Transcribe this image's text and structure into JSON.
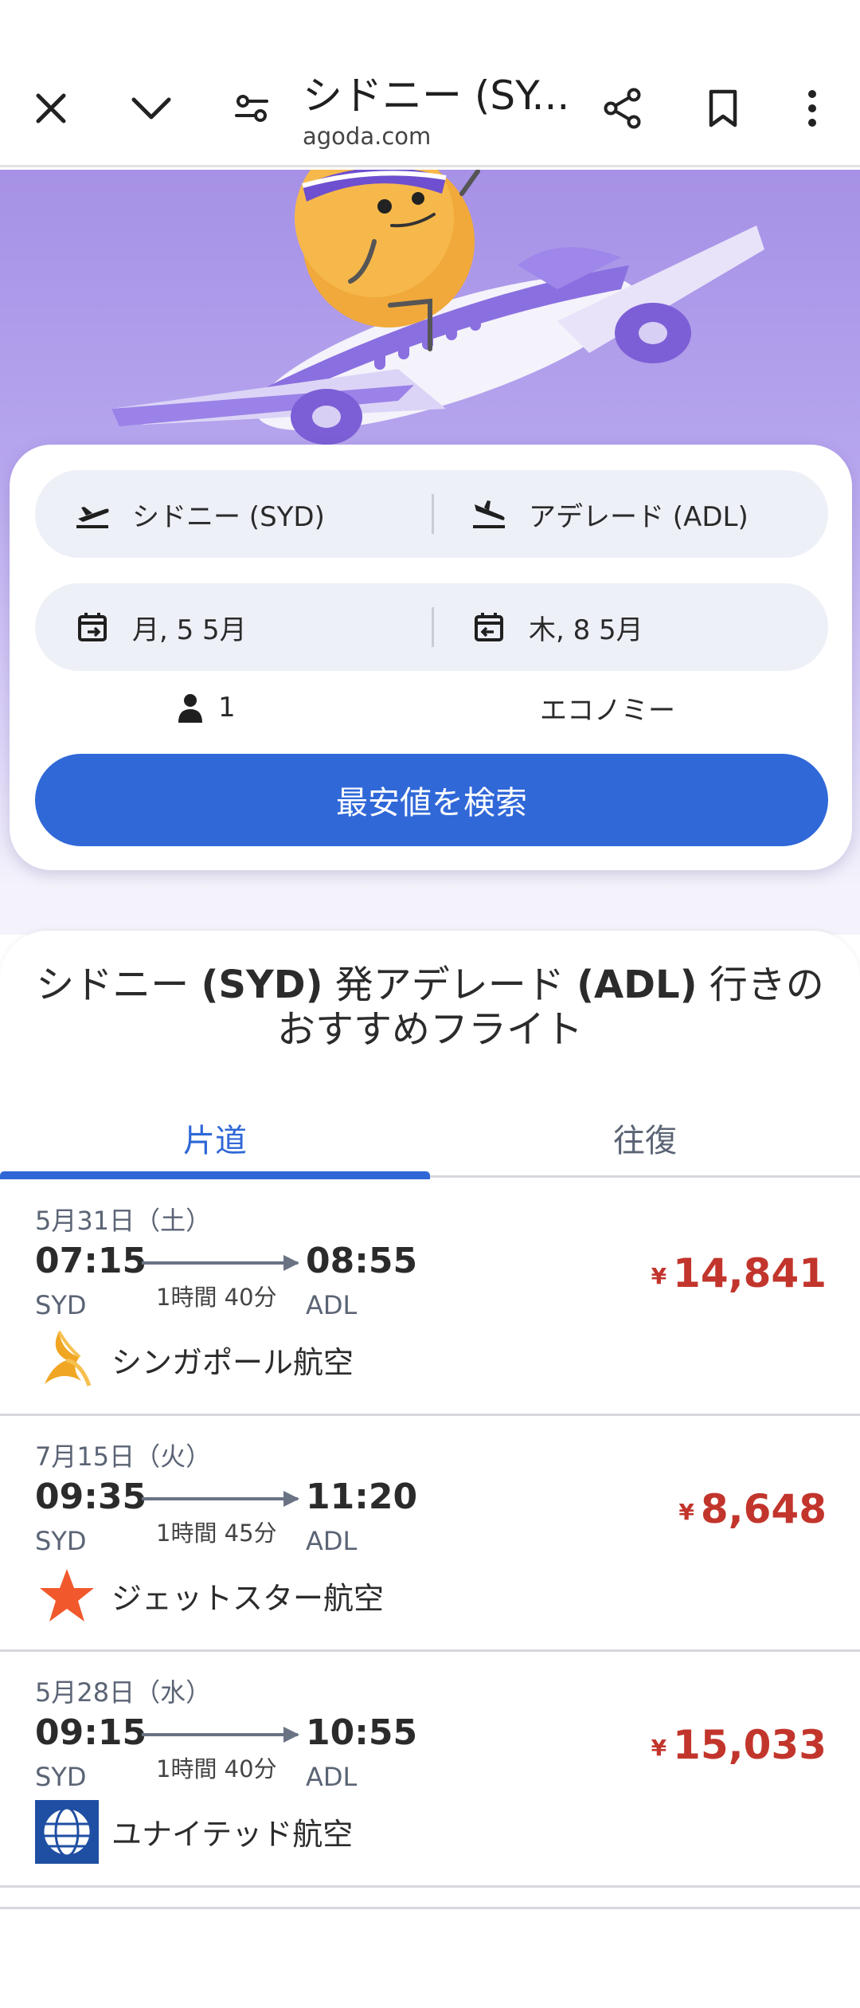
{
  "browser": {
    "title": "シドニー (SY...",
    "domain": "agoda.com",
    "icons": [
      "close-icon",
      "chevron-down-icon",
      "page-settings-icon",
      "share-icon",
      "bookmark-icon",
      "more-vert-icon"
    ]
  },
  "search": {
    "origin": "シドニー (SYD)",
    "destination": "アデレード (ADL)",
    "depart_date": "月, 5 5月",
    "return_date": "木, 8 5月",
    "passengers": "1",
    "cabin": "エコノミー",
    "search_button": "最安値を検索"
  },
  "recommendations": {
    "title_parts": [
      "シドニー ",
      "(SYD)",
      " 発アデレード ",
      "(ADL)",
      " 行きのおすすめフライト"
    ],
    "tabs": [
      {
        "label": "片道",
        "active": true
      },
      {
        "label": "往復",
        "active": false
      }
    ],
    "flights": [
      {
        "date": "5月31日（土）",
        "dep_time": "07:15",
        "dep_code": "SYD",
        "arr_time": "08:55",
        "arr_code": "ADL",
        "duration": "1時間 40分",
        "airline": "シンガポール航空",
        "logo": "singapore-airlines-logo",
        "currency": "¥",
        "price": "14,841"
      },
      {
        "date": "7月15日（火）",
        "dep_time": "09:35",
        "dep_code": "SYD",
        "arr_time": "11:20",
        "arr_code": "ADL",
        "duration": "1時間 45分",
        "airline": "ジェットスター航空",
        "logo": "jetstar-logo",
        "currency": "¥",
        "price": "8,648"
      },
      {
        "date": "5月28日（水）",
        "dep_time": "09:15",
        "dep_code": "SYD",
        "arr_time": "10:55",
        "arr_code": "ADL",
        "duration": "1時間 40分",
        "airline": "ユナイテッド航空",
        "logo": "united-airlines-logo",
        "currency": "¥",
        "price": "15,033"
      }
    ]
  },
  "colors": {
    "accent": "#3068d8",
    "price": "#c2352c",
    "hero": "#a691e6"
  }
}
